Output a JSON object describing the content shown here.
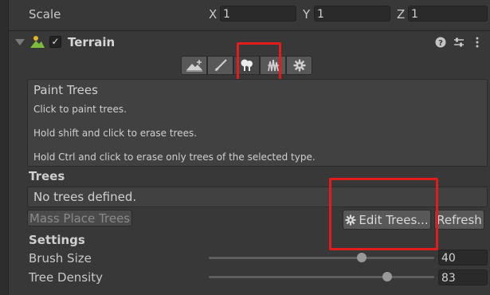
{
  "transform": {
    "scale_label": "Scale",
    "axes": [
      {
        "axis": "X",
        "value": "1"
      },
      {
        "axis": "Y",
        "value": "1"
      },
      {
        "axis": "Z",
        "value": "1"
      }
    ]
  },
  "component": {
    "title": "Terrain",
    "enabled_mark": "✓",
    "header_icons": [
      "help-icon",
      "presets-icon",
      "more-options-icon"
    ]
  },
  "toolbar": {
    "tools": [
      "raise-terrain-icon",
      "paint-brush-icon",
      "paint-trees-icon",
      "paint-details-icon",
      "settings-icon"
    ],
    "active_index": 2
  },
  "help": {
    "title": "Paint Trees",
    "lines": [
      "Click to paint trees.",
      "Hold shift and click to erase trees.",
      "Hold Ctrl and click to erase only trees of the selected type."
    ]
  },
  "trees": {
    "section_title": "Trees",
    "empty_text": "No trees defined.",
    "mass_place_label": "Mass Place Trees",
    "edit_label": "Edit Trees...",
    "refresh_label": "Refresh"
  },
  "settings": {
    "section_title": "Settings",
    "sliders": [
      {
        "label": "Brush Size",
        "value": "40",
        "fraction": 0.68
      },
      {
        "label": "Tree Density",
        "value": "83",
        "fraction": 0.79
      }
    ]
  },
  "colors": {
    "highlight": "#e31b1b",
    "background": "#383838"
  }
}
